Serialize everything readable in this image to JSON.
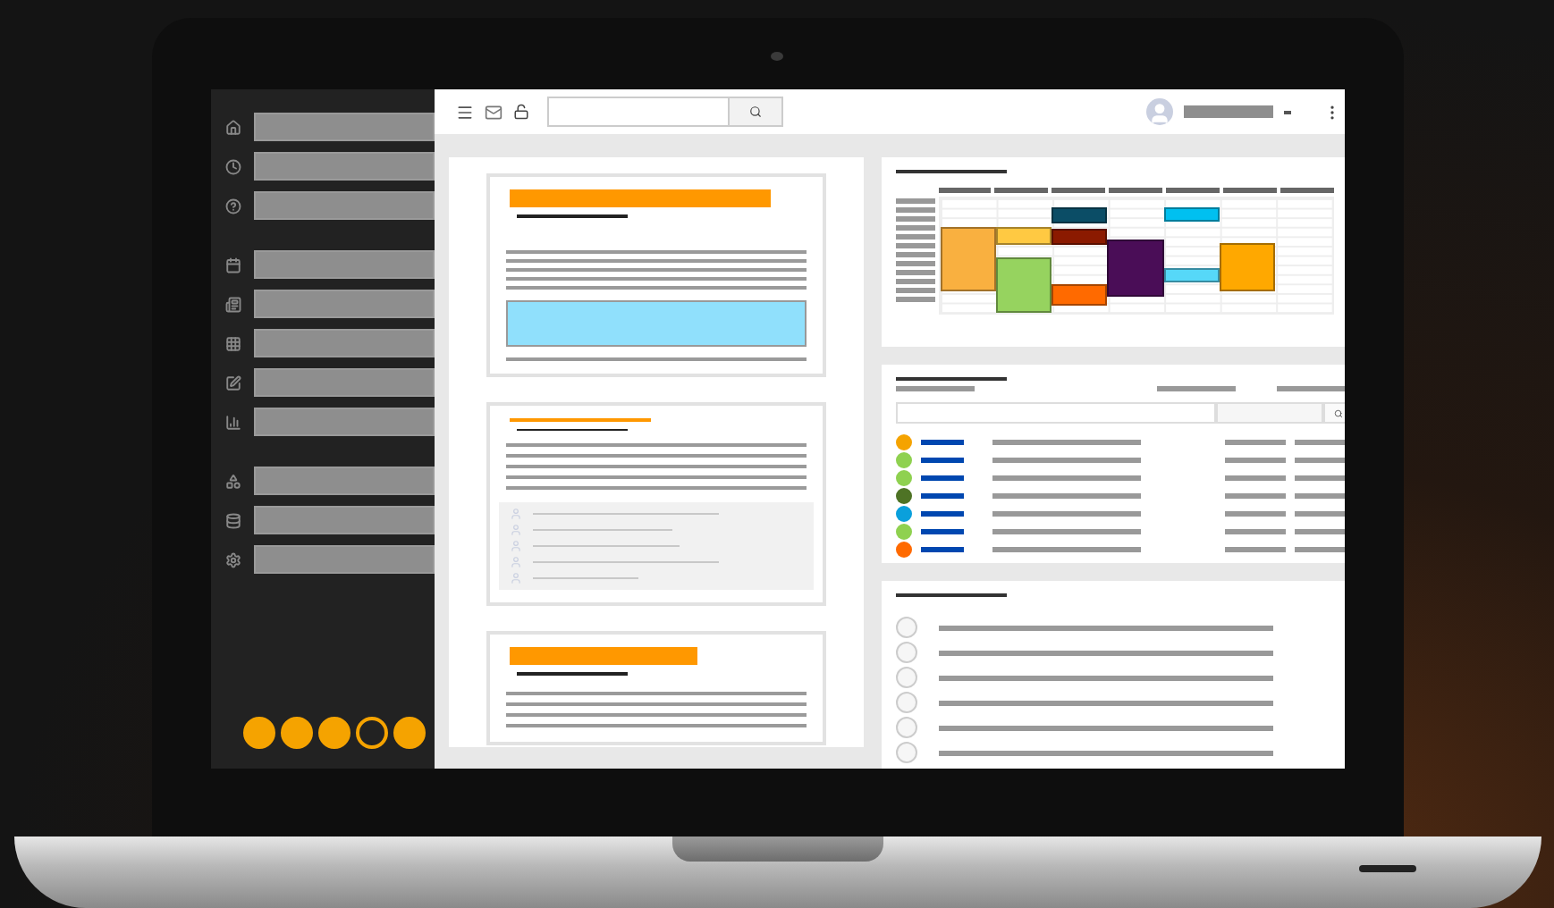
{
  "pager": {
    "dots": [
      {
        "filled": true
      },
      {
        "filled": true
      },
      {
        "filled": true
      },
      {
        "filled": false
      },
      {
        "filled": true
      }
    ]
  },
  "calendar": {
    "events": [
      {
        "color": "#f9b040"
      },
      {
        "color": "#ffc942"
      },
      {
        "color": "#96d35f"
      },
      {
        "color": "#0b4d66"
      },
      {
        "color": "#8b1a00"
      },
      {
        "color": "#ff6a00"
      },
      {
        "color": "#4a0d57"
      },
      {
        "color": "#00c0f0"
      },
      {
        "color": "#56d8f8"
      },
      {
        "color": "#ffa800"
      }
    ]
  },
  "status_list": {
    "rows": [
      {
        "color": "#f5a300"
      },
      {
        "color": "#8fd150"
      },
      {
        "color": "#8fd150"
      },
      {
        "color": "#4e7325"
      },
      {
        "color": "#0aa0dc"
      },
      {
        "color": "#8fd150"
      },
      {
        "color": "#ff6a00"
      }
    ]
  },
  "radio_list": {
    "items": [
      {
        "selected": false
      },
      {
        "selected": false
      },
      {
        "selected": false
      },
      {
        "selected": false
      },
      {
        "selected": false
      },
      {
        "selected": false
      }
    ]
  }
}
